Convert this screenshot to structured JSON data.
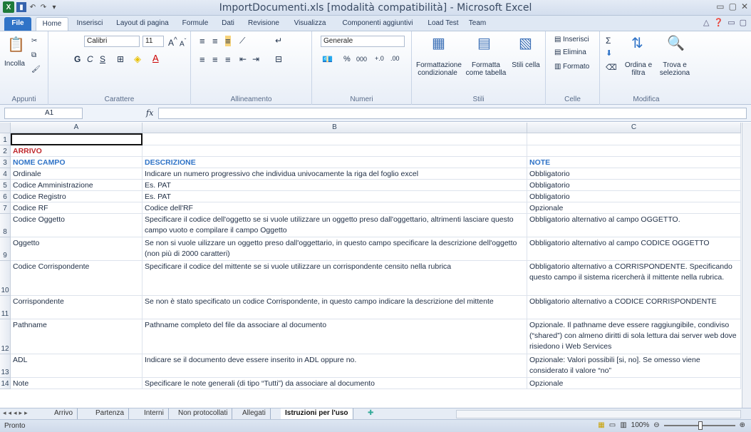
{
  "window": {
    "title": "ImportDocumenti.xls  [modalità compatibilità]  -  Microsoft Excel"
  },
  "ribbon_tabs": [
    "File",
    "Home",
    "Inserisci",
    "Layout di pagina",
    "Formule",
    "Dati",
    "Revisione",
    "Visualizza",
    "Componenti aggiuntivi",
    "Load Test",
    "Team"
  ],
  "ribbon": {
    "clipboard": {
      "paste": "Incolla",
      "title": "Appunti"
    },
    "font": {
      "name": "Calibri",
      "size": "11",
      "bold": "G",
      "italic": "C",
      "underline": "S",
      "title": "Carattere"
    },
    "align": {
      "title": "Allineamento"
    },
    "number": {
      "format": "Generale",
      "percent": "%",
      "thousands": "000",
      "title": "Numeri"
    },
    "styles": {
      "cond": "Formattazione condizionale",
      "table": "Formatta come tabella",
      "cell": "Stili cella",
      "title": "Stili"
    },
    "cells": {
      "insert": "Inserisci",
      "delete": "Elimina",
      "format": "Formato",
      "title": "Celle"
    },
    "edit": {
      "sort": "Ordina e filtra",
      "find": "Trova e seleziona",
      "title": "Modifica"
    }
  },
  "formula_bar": {
    "name_box": "A1",
    "fx": "fx",
    "value": ""
  },
  "columns": [
    "A",
    "B",
    "C"
  ],
  "rows": [
    {
      "n": "1",
      "a": "",
      "b": "",
      "c": "",
      "h": 17
    },
    {
      "n": "2",
      "a": "ARRIVO",
      "b": "",
      "c": "",
      "h": 16,
      "style": "arr"
    },
    {
      "n": "3",
      "a": "NOME CAMPO",
      "b": "DESCRIZIONE",
      "c": "NOTE",
      "h": 16,
      "style": "hdr"
    },
    {
      "n": "4",
      "a": "Ordinale",
      "b": "Indicare un numero progressivo che individua univocamente la riga del foglio excel",
      "c": "Obbligatorio",
      "h": 16
    },
    {
      "n": "5",
      "a": "Codice Amministrazione",
      "b": "Es. PAT",
      "c": "Obbligatorio",
      "h": 16
    },
    {
      "n": "6",
      "a": "Codice Registro",
      "b": "Es. PAT",
      "c": "Obbligatorio",
      "h": 16
    },
    {
      "n": "7",
      "a": "Codice RF",
      "b": "Codice dell'RF",
      "c": "Opzionale",
      "h": 16
    },
    {
      "n": "8",
      "a": "Codice Oggetto",
      "b": "Specificare il codice dell'oggetto se si vuole utilizzare un oggetto preso dall'oggettario, altrimenti lasciare questo campo vuoto e compilare il campo Oggetto",
      "c": "Obbligatorio alternativo al campo OGGETTO.",
      "h": 33
    },
    {
      "n": "9",
      "a": "Oggetto",
      "b": "Se non si vuole uilizzare un oggetto preso dall'oggettario, in questo campo specificare la descrizione dell'oggetto (non più di 2000 caratteri)",
      "c": "Obbligatorio alternativo al campo CODICE OGGETTO",
      "h": 33
    },
    {
      "n": "10",
      "a": "Codice Corrispondente",
      "b": "Specificare il codice del mittente se si vuole utilizzare un corrispondente censito nella rubrica",
      "c": "Obbligatorio alternativo a CORRISPONDENTE. Specificando questo campo il sistema ricercherà il mittente nella rubrica.",
      "h": 49
    },
    {
      "n": "11",
      "a": "Corrispondente",
      "b": "Se non è stato specificato un codice  Corrispondente, in questo campo indicare la descrizione del mittente",
      "c": "Obbligatorio alternativo a CODICE CORRISPONDENTE",
      "h": 33
    },
    {
      "n": "12",
      "a": "Pathname",
      "b": "Pathname completo del file da associare al documento",
      "c": "Opzionale. Il pathname deve essere raggiungibile, condiviso (“shared”) con almeno diritti di sola lettura dai server web dove risiedono i Web Services",
      "h": 49
    },
    {
      "n": "13",
      "a": "ADL",
      "b": "Indicare se il documento deve essere inserito in ADL oppure no.",
      "c": "Opzionale: Valori possibili [si, no]. Se omesso viene considerato il valore “no”",
      "h": 33
    },
    {
      "n": "14",
      "a": "Note",
      "b": "Specificare le note generali (di tipo “Tutti”) da associare al documento",
      "c": "Opzionale",
      "h": 16
    }
  ],
  "sheet_tabs": [
    "Arrivo",
    "Partenza",
    "Interni",
    "Non protocollati",
    "Allegati",
    "Istruzioni per l'uso"
  ],
  "active_sheet": "Istruzioni per l'uso",
  "status": {
    "left": "Pronto",
    "zoom": "100%"
  }
}
